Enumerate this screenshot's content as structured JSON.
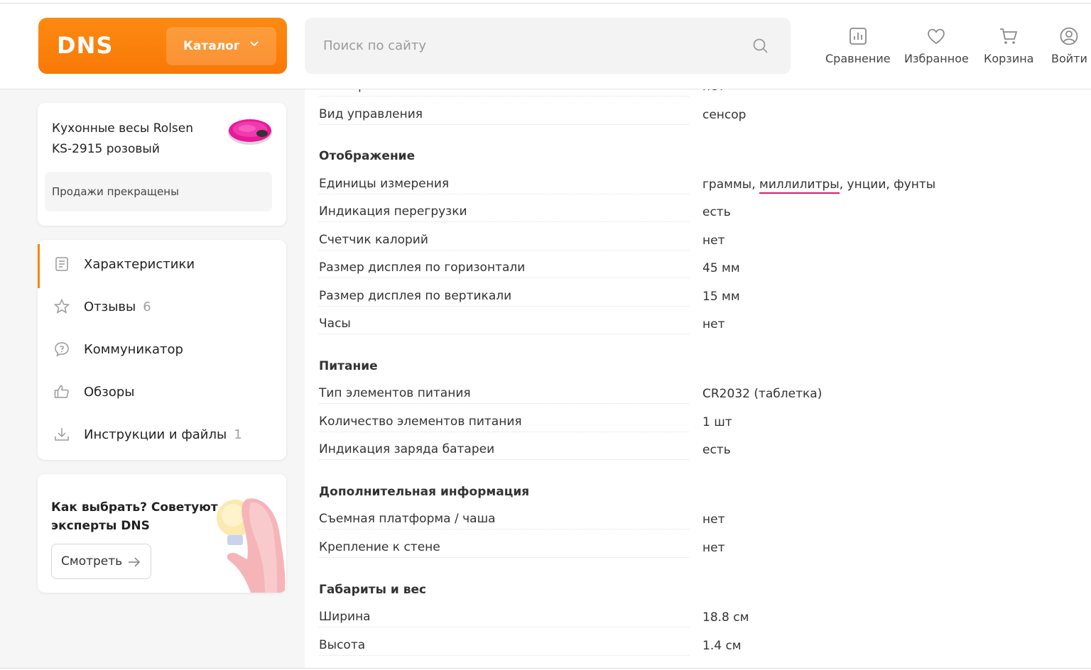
{
  "header": {
    "logo": "DNS",
    "catalog_label": "Каталог",
    "search_placeholder": "Поиск по сайту",
    "nav": {
      "compare": "Сравнение",
      "favorites": "Избранное",
      "cart": "Корзина",
      "login": "Войти"
    }
  },
  "product": {
    "title": "Кухонные весы Rolsen KS-2915 розовый",
    "status": "Продажи прекращены"
  },
  "menu": {
    "items": [
      {
        "label": "Характеристики",
        "count": ""
      },
      {
        "label": "Отзывы",
        "count": "6"
      },
      {
        "label": "Коммуникатор",
        "count": ""
      },
      {
        "label": "Обзоры",
        "count": ""
      },
      {
        "label": "Инструкции и файлы",
        "count": "1"
      }
    ]
  },
  "expert": {
    "title": "Как выбрать? Советуют эксперты DNS",
    "button": "Смотреть"
  },
  "specs": {
    "partial_top": {
      "name": "Таймер",
      "value": "нет"
    },
    "control": {
      "name": "Вид управления",
      "value": "сенсор"
    },
    "display": {
      "heading": "Отображение",
      "units": {
        "name": "Единицы измерения",
        "value_a": "граммы, ",
        "value_b": "миллилитры",
        "value_c": ", унции, фунты"
      },
      "rows": [
        {
          "name": "Индикация перегрузки",
          "value": "есть"
        },
        {
          "name": "Счетчик калорий",
          "value": "нет"
        },
        {
          "name": "Размер дисплея по горизонтали",
          "value": "45 мм"
        },
        {
          "name": "Размер дисплея по вертикали",
          "value": "15 мм"
        },
        {
          "name": "Часы",
          "value": "нет"
        }
      ]
    },
    "power": {
      "heading": "Питание",
      "rows": [
        {
          "name": "Тип элементов питания",
          "value": "CR2032 (таблетка)"
        },
        {
          "name": "Количество элементов питания",
          "value": "1 шт"
        },
        {
          "name": "Индикация заряда батареи",
          "value": "есть"
        }
      ]
    },
    "extra": {
      "heading": "Дополнительная информация",
      "rows": [
        {
          "name": "Съемная платформа / чаша",
          "value": "нет"
        },
        {
          "name": "Крепление к стене",
          "value": "нет"
        }
      ]
    },
    "size": {
      "heading": "Габариты и вес",
      "rows": [
        {
          "name": "Ширина",
          "value": "18.8 см"
        },
        {
          "name": "Высота",
          "value": "1.4 см"
        }
      ]
    }
  },
  "colors": {
    "brand_orange": "#fc8507",
    "highlight_underline": "#e0186c"
  }
}
